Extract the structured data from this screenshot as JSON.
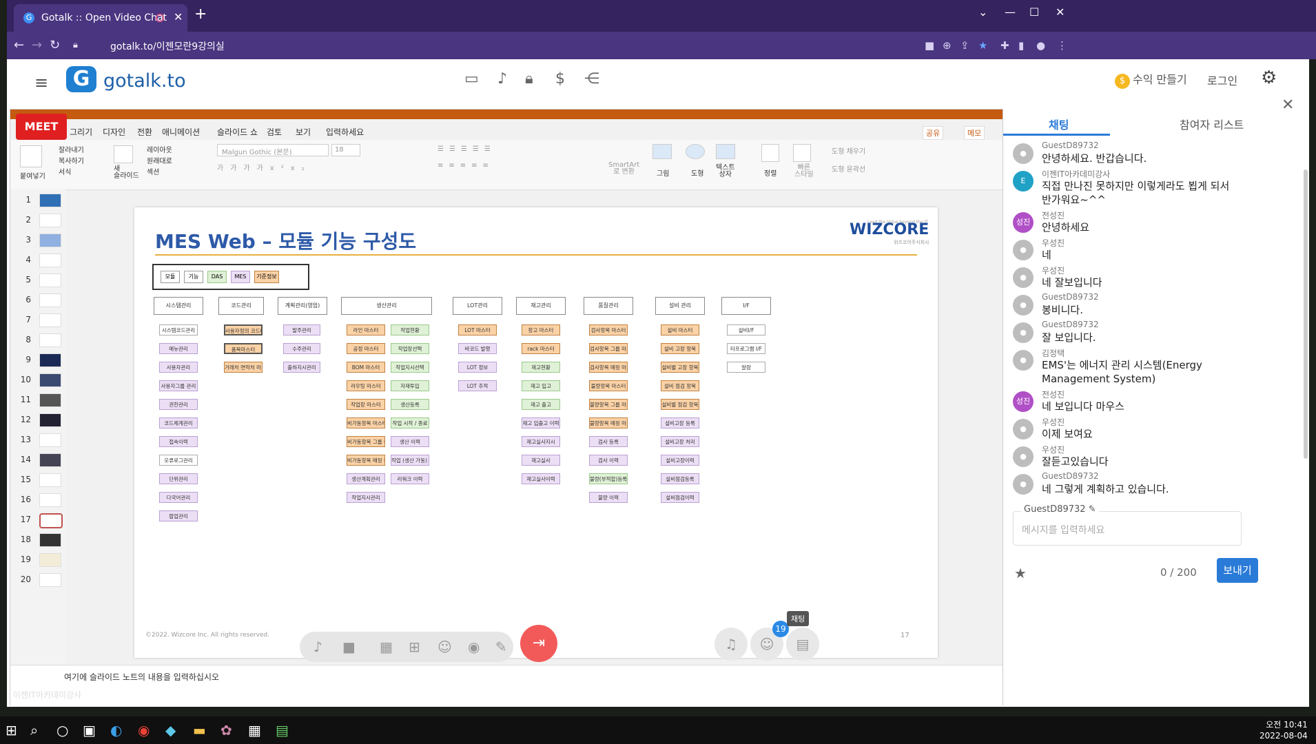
{
  "browser": {
    "tab_title": "Gotalk :: Open Video Chat",
    "url": "gotalk.to/이젠모란9강의실"
  },
  "header": {
    "logo_text": "gotalk.to",
    "earn_label": "수익 만들기",
    "login_label": "로그인"
  },
  "meet_badge": "MEET",
  "ppt": {
    "menus": [
      "그리기",
      "디자인",
      "전환",
      "애니메이션",
      "슬라이드 쇼",
      "검토",
      "보기",
      "입력하세요"
    ],
    "share": "공유",
    "memo": "메모",
    "ribbon": {
      "paste": "붙여넣기",
      "cut": "잘라내기",
      "copy": "복사하기",
      "format": "서식",
      "new_slide": "새\n슬라이드",
      "layout": "레이아웃",
      "reset": "원래대로",
      "section": "섹션",
      "font": "Malgun Gothic (본문)",
      "size": "18",
      "smartart": "SmartArt\n로 변환",
      "picture": "그림",
      "shape": "도형",
      "textbox": "텍스트\n상자",
      "arrange": "정렬",
      "quick": "빠른\n스타일",
      "fill": "도형 채우기",
      "outline": "도형 윤곽선"
    },
    "thumbs": [
      "1",
      "2",
      "3",
      "4",
      "5",
      "6",
      "7",
      "8",
      "9",
      "10",
      "11",
      "12",
      "13",
      "14",
      "15",
      "16",
      "17",
      "18",
      "19",
      "20"
    ],
    "notes_placeholder": "여기에 슬라이드 노트의 내용을 입력하십시오"
  },
  "slide": {
    "title": "MES Web – 모듈 기능 구성도",
    "brand": "WIZCORE",
    "brand_slogan": "Lead the Value beyond the IT",
    "brand_sub": "위즈코어주식회사",
    "legend": [
      "모듈",
      "기능",
      "DAS",
      "MES",
      "기준정보"
    ],
    "columns": [
      {
        "name": "시스템관리",
        "items": [
          [
            "시스템코드관리",
            "w"
          ],
          [
            "메뉴관리",
            "p"
          ],
          [
            "사용자관리",
            "p"
          ],
          [
            "사용자그룹 관리",
            "p"
          ],
          [
            "권한관리",
            "p"
          ],
          [
            "코드체계관리",
            "p"
          ],
          [
            "접속이력",
            "p"
          ],
          [
            "오류로그관리",
            "w"
          ],
          [
            "단위관리",
            "p"
          ],
          [
            "다국어관리",
            "p"
          ],
          [
            "팝업관리",
            "p"
          ]
        ]
      },
      {
        "name": "코드관리",
        "items": [
          [
            "사용자정의 코드마스터",
            "ob"
          ],
          [
            "품목마스터",
            "ob"
          ],
          [
            "거래처 연락처 마스터",
            "o"
          ]
        ]
      },
      {
        "name": "계획관리(영업)",
        "items": [
          [
            "발주관리",
            "p"
          ],
          [
            "수주관리",
            "p"
          ],
          [
            "출하지시관리",
            "p"
          ]
        ]
      },
      {
        "name": "생산관리",
        "items": [
          [
            "라인 마스터",
            "o"
          ],
          [
            "공정 마스터",
            "o"
          ],
          [
            "BOM 마스터",
            "o"
          ],
          [
            "라우팅 마스터",
            "o"
          ],
          [
            "작업장 마스터",
            "o"
          ],
          [
            "비가동항목 마스터",
            "o"
          ],
          [
            "비가동항목 그룹 마스터",
            "o"
          ],
          [
            "비가동항목 매핑 마스터",
            "o"
          ],
          [
            "생산계획관리",
            "p"
          ],
          [
            "작업지시관리",
            "p"
          ]
        ]
      },
      {
        "name": "",
        "items": [
          [
            "작업현황",
            "g"
          ],
          [
            "작업장선택",
            "g"
          ],
          [
            "작업지시선택",
            "g"
          ],
          [
            "자재투입",
            "g"
          ],
          [
            "생산등록",
            "g"
          ],
          [
            "작업 시작 / 종료",
            "g"
          ],
          [
            "생산 이력",
            "p"
          ],
          [
            "작업 (생산 가동) 이력",
            "p"
          ],
          [
            "리워크 이력",
            "p"
          ]
        ]
      },
      {
        "name": "LOT관리",
        "items": [
          [
            "LOT 마스터",
            "o"
          ],
          [
            "바코드 발행",
            "p"
          ],
          [
            "LOT 정보",
            "p"
          ],
          [
            "LOT 추적",
            "p"
          ]
        ]
      },
      {
        "name": "재고관리",
        "items": [
          [
            "창고 마스터",
            "o"
          ],
          [
            "rack 마스터",
            "o"
          ],
          [
            "재고현황",
            "g"
          ],
          [
            "재고 입고",
            "g"
          ],
          [
            "재고 출고",
            "g"
          ],
          [
            "재고 입출고 이력",
            "p"
          ],
          [
            "재고실사지시",
            "p"
          ],
          [
            "재고실사",
            "p"
          ],
          [
            "재고실사이력",
            "p"
          ]
        ]
      },
      {
        "name": "품질관리",
        "items": [
          [
            "검사항목 마스터",
            "o"
          ],
          [
            "검사항목 그룹 마스터",
            "o"
          ],
          [
            "검사항목 매핑 마스터",
            "o"
          ],
          [
            "불량항목 마스터",
            "o"
          ],
          [
            "불량항목 그룹 마스터",
            "o"
          ],
          [
            "불량항목 매핑 마스터",
            "o"
          ],
          [
            "검사 등록",
            "p"
          ],
          [
            "검사 이력",
            "p"
          ],
          [
            "불량(부적합)등록",
            "g"
          ],
          [
            "불량 이력",
            "p"
          ]
        ]
      },
      {
        "name": "설비 관리",
        "items": [
          [
            "설비 마스터",
            "o"
          ],
          [
            "설비 고장 항목",
            "o"
          ],
          [
            "설비별 고장 항목",
            "o"
          ],
          [
            "설비 점검 항목",
            "o"
          ],
          [
            "설비별 점검 항목",
            "o"
          ],
          [
            "설비고장 등록",
            "p"
          ],
          [
            "설비고장 처리",
            "p"
          ],
          [
            "설비고장이력",
            "p"
          ],
          [
            "설비점검등록",
            "p"
          ],
          [
            "설비점검이력",
            "p"
          ]
        ]
      },
      {
        "name": "I/F",
        "items": [
          [
            "설비I/F",
            "w"
          ],
          [
            "타프로그램 I/F",
            "w"
          ],
          [
            "알람",
            "w"
          ]
        ]
      }
    ],
    "copyright": "©2022. Wizcore Inc. All rights reserved.",
    "page_no": "17"
  },
  "watermark": "이젠IT아카데미강사",
  "participants_badge": "19",
  "chat_tag": "채팅",
  "side": {
    "tab_chat": "채팅",
    "tab_participants": "참여자 리스트",
    "messages": [
      {
        "name": "GuestD89732",
        "text": "안녕하세요. 반갑습니다.",
        "avatar": "user"
      },
      {
        "name": "이젠IT아카데미강사",
        "text": "직접 만나진 못하지만 이렇게라도 뵙게 되서 반가워요~^^",
        "avatar": "E"
      },
      {
        "name": "전성진",
        "text": "안녕하세요",
        "avatar": "성진"
      },
      {
        "name": "우성진",
        "text": "네",
        "avatar": "user"
      },
      {
        "name": "우성진",
        "text": "네 잘보입니다",
        "avatar": "user"
      },
      {
        "name": "GuestD89732",
        "text": "봉비니다.",
        "avatar": "user"
      },
      {
        "name": "GuestD89732",
        "text": "잘 보입니다.",
        "avatar": "user"
      },
      {
        "name": "김정택",
        "text": "EMS'는 에너지 관리 시스템(Energy Management System)",
        "avatar": "user"
      },
      {
        "name": "전성진",
        "text": "네 보입니다 마우스",
        "avatar": "성진"
      },
      {
        "name": "우성진",
        "text": "이제 보여요",
        "avatar": "user"
      },
      {
        "name": "우성진",
        "text": "잘듣고있습니다",
        "avatar": "user"
      },
      {
        "name": "GuestD89732",
        "text": "네 그렇게 계획하고 있습니다.",
        "avatar": "user"
      }
    ],
    "input_name": "GuestD89732",
    "input_placeholder": "메시지를 입력하세요",
    "counter": "0 / 200",
    "send_label": "보내기"
  },
  "taskbar": {
    "time": "오전 10:41",
    "date": "2022-08-04"
  }
}
